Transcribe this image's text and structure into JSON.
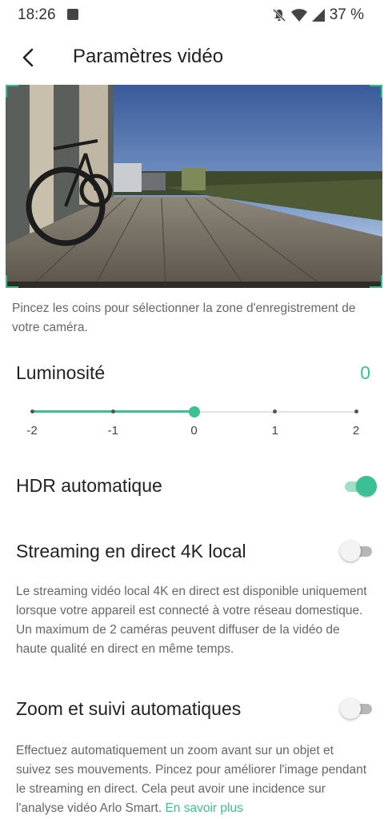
{
  "status_bar": {
    "time": "18:26",
    "battery": "37 %"
  },
  "header": {
    "title": "Paramètres vidéo"
  },
  "preview": {
    "caption": "Pincez les coins pour sélectionner la zone d'enregistrement de votre caméra."
  },
  "brightness": {
    "label": "Luminosité",
    "value": "0",
    "ticks": [
      "-2",
      "-1",
      "0",
      "1",
      "2"
    ],
    "selected_index": 2,
    "range": [
      -2,
      2
    ]
  },
  "hdr": {
    "label": "HDR automatique",
    "enabled": true
  },
  "streaming_4k": {
    "label": "Streaming en direct 4K local",
    "enabled": false,
    "description": "Le streaming vidéo local 4K en direct est disponible uniquement lorsque votre appareil est connecté à votre réseau domestique. Un maximum de 2 caméras peuvent diffuser de la vidéo de haute qualité en direct en même temps."
  },
  "zoom_tracking": {
    "label": "Zoom et suivi automatiques",
    "enabled": false,
    "description": "Effectuez automatiquement un zoom avant sur un objet et suivez ses mouvements. Pincez pour améliorer l'image pendant le streaming en direct. Cela peut avoir une incidence sur l'analyse vidéo Arlo Smart.",
    "link": "En savoir plus"
  },
  "colors": {
    "accent": "#3bbf94",
    "text": "#222222",
    "secondary": "#666666"
  },
  "icons": [
    "image-icon",
    "mute-bell-icon",
    "wifi-icon",
    "signal-icon",
    "back-arrow-icon",
    "bicycle-icon"
  ]
}
